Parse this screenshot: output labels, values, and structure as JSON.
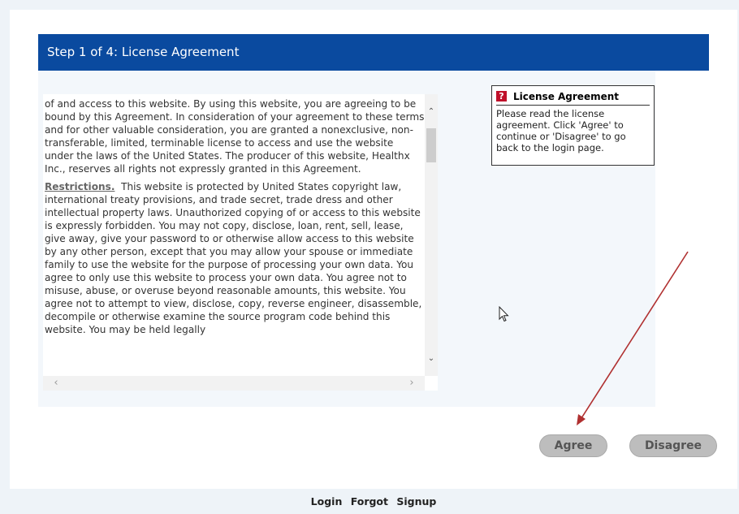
{
  "header": {
    "title": "Step 1 of 4: License Agreement"
  },
  "agreement": {
    "paragraph1": "of and access to this website. By using this website, you are agreeing to be bound by this Agreement. In consideration of your agreement to these terms and for other valuable consideration, you are granted a nonexclusive, non-transferable, limited, terminable license to access and use the website under the laws of the United States. The producer of this website, Healthx Inc., reserves all rights not expressly granted in this Agreement.",
    "restrictions_heading": "Restrictions.",
    "restrictions_text": "This website is protected by United States copyright law, international treaty provisions, and trade secret, trade dress and other intellectual property laws. Unauthorized copying of or access to this website is expressly forbidden. You may not copy, disclose, loan, rent, sell, lease, give away, give your password to or otherwise allow access to this website by any other person, except that you may allow your spouse or immediate family to use the website for the purpose of processing your own data. You agree to only use this website to process your own data. You agree not to misuse, abuse, or overuse beyond reasonable amounts, this website. You agree not to attempt to view, disclose, copy, reverse engineer, disassemble, decompile or otherwise examine the source program code behind this website. You may be held legally"
  },
  "help": {
    "icon": "question-icon",
    "title": "License Agreement",
    "body": "Please read the license agreement. Click 'Agree' to continue or 'Disagree' to go back to the login page."
  },
  "buttons": {
    "agree": "Agree",
    "disagree": "Disagree"
  },
  "footer": {
    "login": "Login",
    "forgot": "Forgot",
    "signup": "Signup"
  },
  "colors": {
    "header_bg": "#0a4a9f",
    "annotation_arrow": "#b03030",
    "help_icon": "#c0102a"
  }
}
